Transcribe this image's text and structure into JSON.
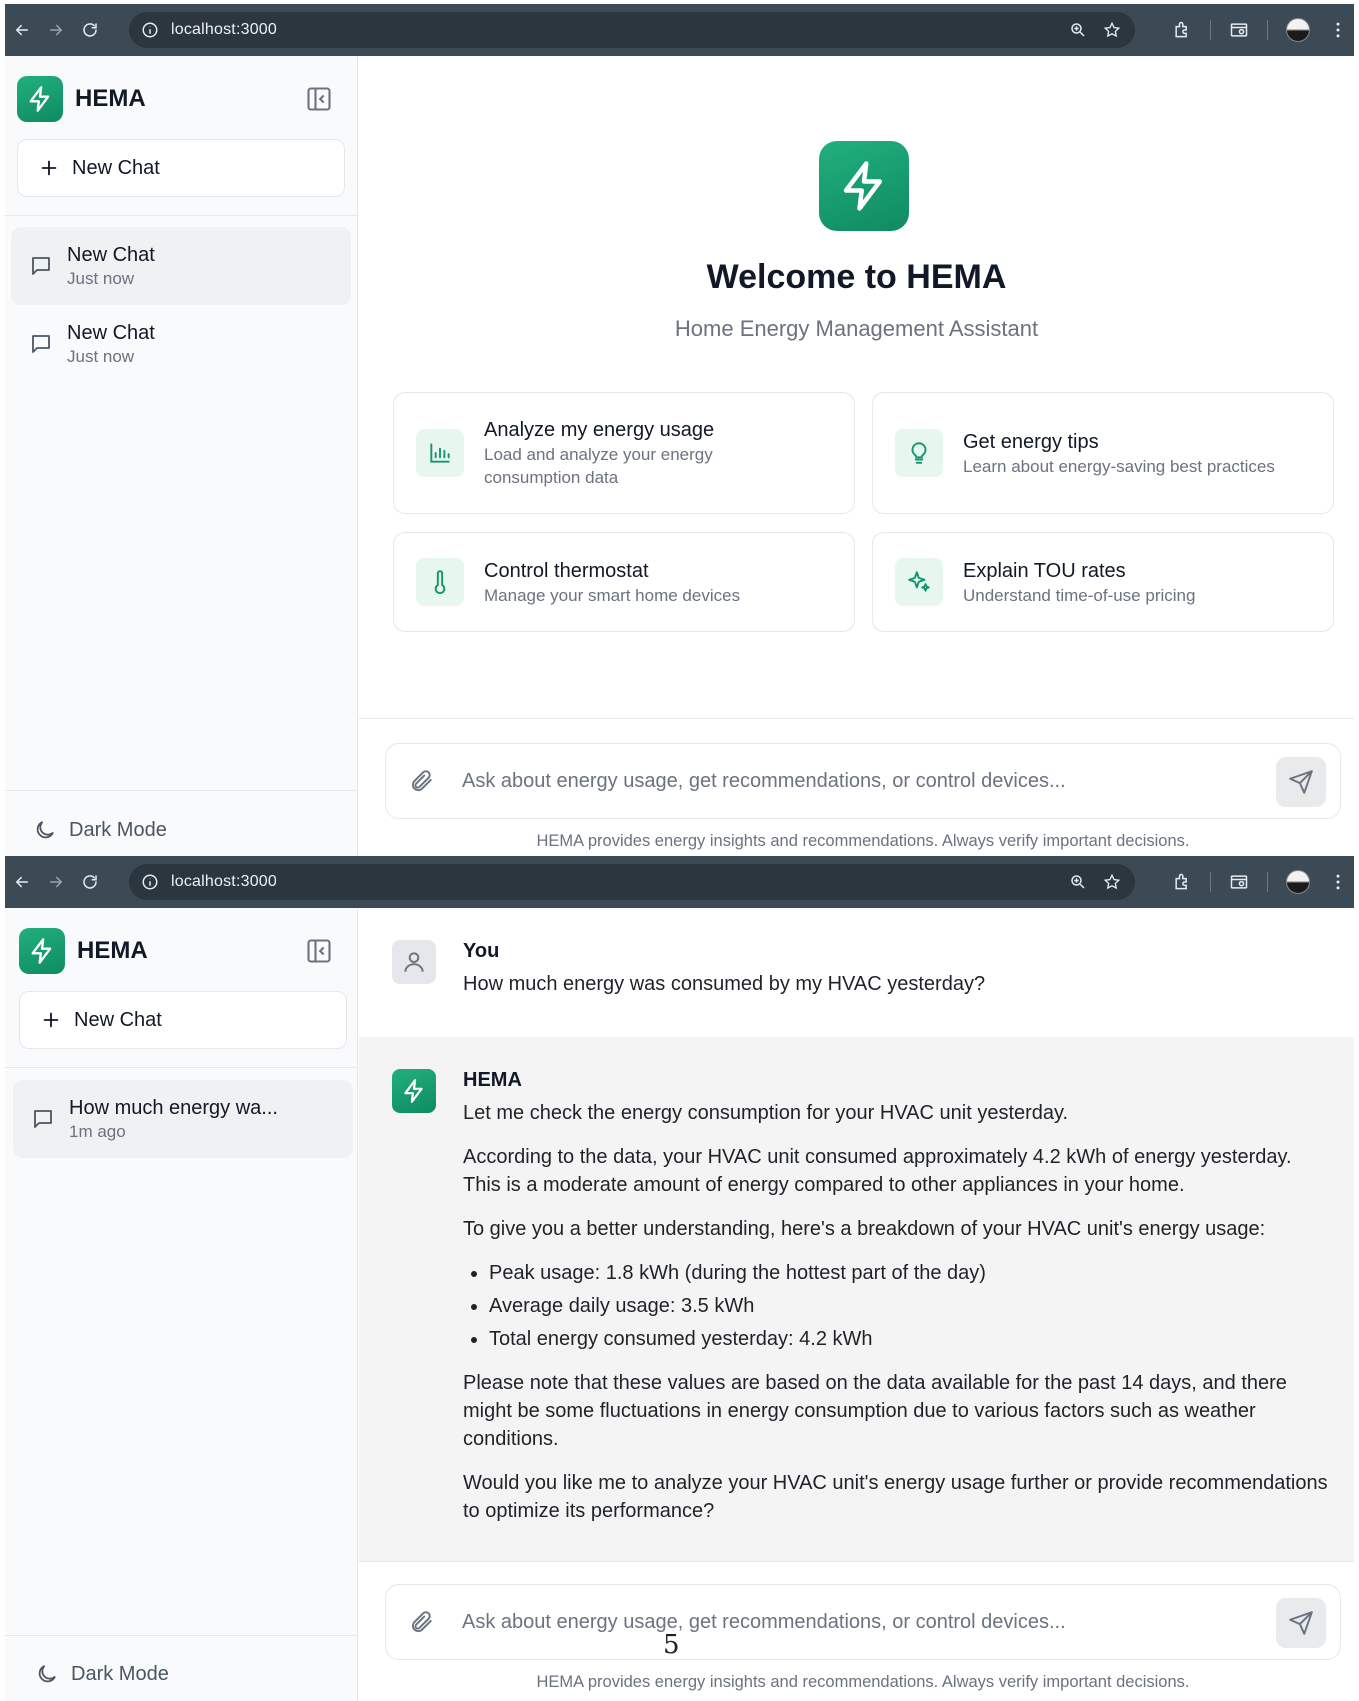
{
  "browser": {
    "url": "localhost:3000"
  },
  "sidebar": {
    "brand": "HEMA",
    "new_chat_label": "New Chat",
    "dark_mode_label": "Dark Mode",
    "screen1_chats": [
      {
        "title": "New Chat",
        "time": "Just now"
      },
      {
        "title": "New Chat",
        "time": "Just now"
      }
    ],
    "screen2_chats": [
      {
        "title": "How much energy wa...",
        "time": "1m ago"
      }
    ]
  },
  "welcome": {
    "title": "Welcome to HEMA",
    "subtitle": "Home Energy Management Assistant",
    "cards": [
      {
        "title": "Analyze my energy usage",
        "desc_line1": "Load and analyze your energy",
        "desc_line2": "consumption data",
        "icon": "bar-chart-icon"
      },
      {
        "title": "Get energy tips",
        "desc": "Learn about energy-saving best practices",
        "icon": "lightbulb-icon"
      },
      {
        "title": "Control thermostat",
        "desc": "Manage your smart home devices",
        "icon": "thermometer-icon"
      },
      {
        "title": "Explain TOU rates",
        "desc": "Understand time-of-use pricing",
        "icon": "sparkles-icon"
      }
    ]
  },
  "input": {
    "placeholder": "Ask about energy usage, get recommendations, or control devices...",
    "disclaimer": "HEMA provides energy insights and recommendations. Always verify important decisions."
  },
  "conversation": {
    "user_name": "You",
    "user_message": "How much energy was consumed by my HVAC yesterday?",
    "bot_name": "HEMA",
    "bot_p1": "Let me check the energy consumption for your HVAC unit yesterday.",
    "bot_p2": "According to the data, your HVAC unit consumed approximately 4.2 kWh of energy yesterday. This is a moderate amount of energy compared to other appliances in your home.",
    "bot_p3": "To give you a better understanding, here's a breakdown of your HVAC unit's energy usage:",
    "bot_bullets": [
      "Peak usage: 1.8 kWh (during the hottest part of the day)",
      "Average daily usage: 3.5 kWh",
      "Total energy consumed yesterday: 4.2 kWh"
    ],
    "bot_p4": "Please note that these values are based on the data available for the past 14 days, and there might be some fluctuations in energy consumption due to various factors such as weather conditions.",
    "bot_p5": "Would you like me to analyze your HVAC unit's energy usage further or provide recommendations to optimize its performance?"
  },
  "page_number": "5",
  "colors": {
    "accent": "#15976b",
    "chrome": "#3c4a56",
    "sidebar_bg": "#f9fafb"
  }
}
